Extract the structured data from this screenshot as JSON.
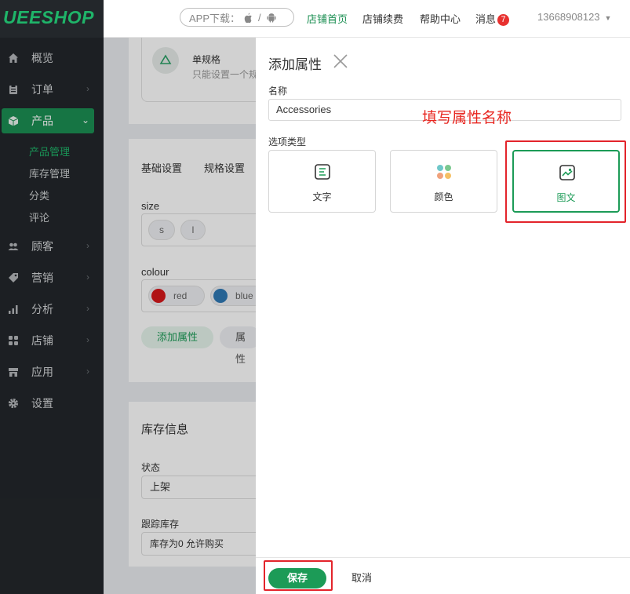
{
  "brand": {
    "logo": "UEESHOP",
    "color": "#1fb469"
  },
  "sidebar": {
    "items": [
      {
        "label": "概览",
        "icon": "home-icon"
      },
      {
        "label": "订单",
        "icon": "clipboard-icon"
      },
      {
        "label": "产品",
        "icon": "box-icon"
      },
      {
        "label": "顾客",
        "icon": "users-icon"
      },
      {
        "label": "营销",
        "icon": "tag-icon"
      },
      {
        "label": "分析",
        "icon": "bar-chart-icon"
      },
      {
        "label": "店铺",
        "icon": "grid-icon"
      },
      {
        "label": "应用",
        "icon": "store-icon"
      },
      {
        "label": "设置",
        "icon": "gear-icon"
      }
    ],
    "product_sub": [
      "产品管理",
      "库存管理",
      "分类",
      "评论"
    ]
  },
  "topbar": {
    "app_download": "APP下载：",
    "slash": "/",
    "shop_home": "店铺首页",
    "renew": "店铺续费",
    "help": "帮助中心",
    "messages": "消息",
    "message_count": "7",
    "user": "13668908123"
  },
  "background": {
    "variant_title": "单规格",
    "variant_desc": "只能设置一个规",
    "tabs": [
      "基础设置",
      "规格设置"
    ],
    "size_label": "size",
    "size_values": [
      "s",
      "l"
    ],
    "colour_label": "colour",
    "colour_values": [
      {
        "name": "red",
        "swatch": "#d7191c"
      },
      {
        "name": "blue",
        "swatch": "#2f79b5"
      }
    ],
    "add_attr": "添加属性",
    "attr_partial": "属性",
    "inventory_title": "库存信息",
    "status_label": "状态",
    "status_value": "上架",
    "track_label": "跟踪库存",
    "track_value": "库存为0 允许购买"
  },
  "drawer": {
    "title": "添加属性",
    "name_label": "名称",
    "name_value": "Accessories",
    "hint": "填写属性名称",
    "type_label": "选项类型",
    "options": [
      {
        "label": "文字",
        "icon": "text-icon"
      },
      {
        "label": "颜色",
        "icon": "palette-icon"
      },
      {
        "label": "图文",
        "icon": "image-icon"
      }
    ],
    "selected_option": "图文",
    "save": "保存",
    "cancel": "取消",
    "accent": "#1c9b57",
    "annotation_color": "#e3242b"
  }
}
